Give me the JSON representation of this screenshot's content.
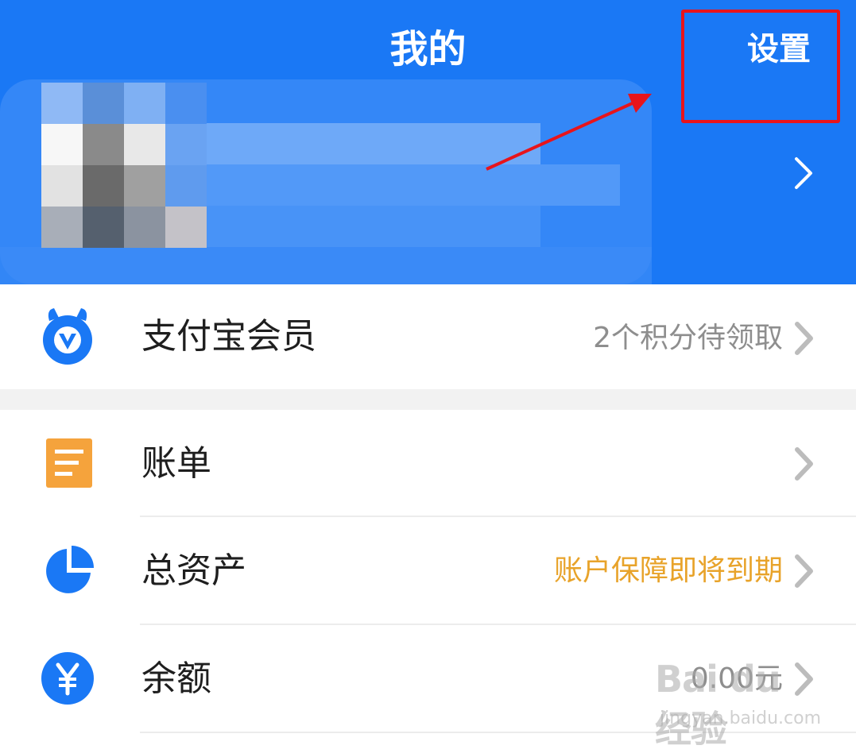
{
  "header": {
    "title": "我的",
    "settings_label": "设置",
    "bg_color": "#1a78f5"
  },
  "profile": {
    "avatar": "pixelated-avatar",
    "chevron_icon": "chevron-right-icon"
  },
  "menu": {
    "member": {
      "label": "支付宝会员",
      "right_text": "2个积分待领取",
      "icon": "member-badge-icon"
    },
    "bill": {
      "label": "账单",
      "icon": "bill-icon"
    },
    "assets": {
      "label": "总资产",
      "right_text": "账户保障即将到期",
      "icon": "pie-chart-icon"
    },
    "balance": {
      "label": "余额",
      "right_text": "0.00元",
      "icon": "yuan-icon"
    }
  },
  "watermark": {
    "logo": "Bai du 经验",
    "site": "jingyan.baidu.com"
  },
  "colors": {
    "accent": "#1a78f5",
    "orange": "#f5a33c",
    "warning_text": "#e8a32a",
    "annotation_red": "#e8141b"
  }
}
